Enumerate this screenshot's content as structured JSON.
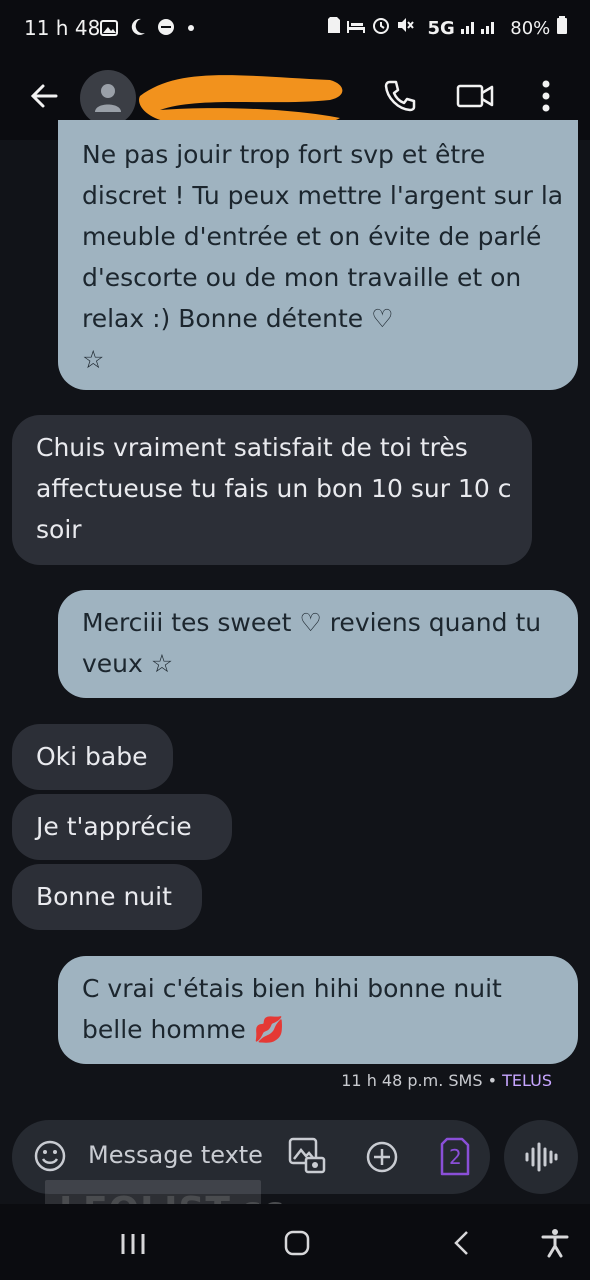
{
  "status_bar": {
    "time": "11 h 48",
    "left_icons": [
      "image-icon",
      "moon-icon",
      "dnd-icon",
      "dot-icon"
    ],
    "right_icons": [
      "sim-icon",
      "bed-icon",
      "alarm-icon",
      "mute-icon",
      "signal-icon"
    ],
    "network": "5G",
    "battery": "80%"
  },
  "header": {
    "contact_name_redacted": "",
    "icons": [
      "back-arrow-icon",
      "avatar-person-icon",
      "phone-icon",
      "video-icon",
      "more-vert-icon"
    ]
  },
  "messages": [
    {
      "direction": "outgoing",
      "lines": [
        "Ne pas jouir trop fort svp et être",
        "discret ! Tu peux mettre l'argent sur la",
        "meuble d'entrée et on évite de parlé",
        "d'escorte ou de mon travaille et on",
        "relax :) Bonne détente ♡",
        "☆"
      ]
    },
    {
      "direction": "incoming",
      "lines": [
        "Chuis vraiment satisfait de toi très",
        "affectueuse tu fais un bon 10 sur 10 c",
        "soir"
      ]
    },
    {
      "direction": "outgoing",
      "lines": [
        "Merciii tes sweet ♡ reviens quand tu",
        "veux ☆"
      ]
    },
    {
      "direction": "incoming",
      "lines": [
        "Oki babe"
      ]
    },
    {
      "direction": "incoming",
      "lines": [
        "Je t'apprécie"
      ]
    },
    {
      "direction": "incoming",
      "lines": [
        "Bonne nuit"
      ]
    },
    {
      "direction": "outgoing",
      "lines": [
        "C vrai c'étais bien hihi bonne nuit",
        "belle homme 💋"
      ]
    }
  ],
  "meta": {
    "time": "11 h 48 p.m.",
    "type": "SMS",
    "separator": "•",
    "carrier": "TELUS"
  },
  "compose": {
    "placeholder": "Message texte",
    "sim_number": "2"
  },
  "watermark": "LEOLIST.cc",
  "colors": {
    "outgoing_bubble": "#9fb3c0",
    "incoming_bubble": "#2c2f37",
    "background": "#111318",
    "carrier": "#c7a6ff",
    "sim_badge": "#8a4fd8"
  }
}
